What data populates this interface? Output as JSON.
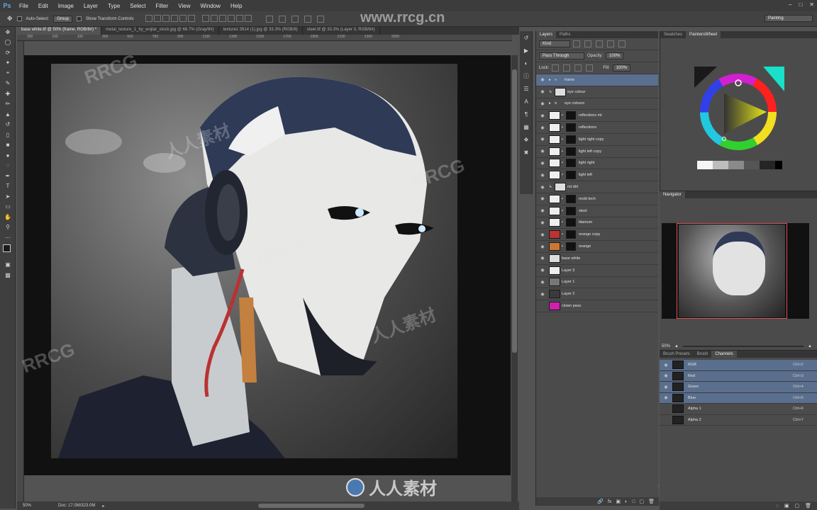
{
  "app": {
    "logo": "Ps",
    "workspace": "Painting"
  },
  "menu": [
    "File",
    "Edit",
    "Image",
    "Layer",
    "Type",
    "Select",
    "Filter",
    "View",
    "Window",
    "Help"
  ],
  "options": {
    "auto_select_label": "Auto-Select:",
    "auto_select_value": "Group",
    "transform_label": "Show Transform Controls"
  },
  "doc_tabs": [
    {
      "label": "base white.tif @ 50% (frame, RGB/8#) *",
      "active": true
    },
    {
      "label": "metal_texture_1_by_wojtar_stock.jpg @ 66.7% (Gray/8#)",
      "active": false
    },
    {
      "label": "texturez 3914 (1).jpg @ 33.3% (RGB/8)",
      "active": false
    },
    {
      "label": "steel.tif @ 33.3% (Layer 0, RGB/8#)",
      "active": false
    }
  ],
  "ruler": [
    "300",
    "100",
    "100",
    "300",
    "500",
    "700",
    "900",
    "1100",
    "1300",
    "1500",
    "1700",
    "1900",
    "2100",
    "2300",
    "2500"
  ],
  "status": {
    "zoom": "50%",
    "doc": "Doc: 17.0M/323.0M"
  },
  "watermark": {
    "site": "www.rrcg.cn",
    "brand": "RRCG",
    "cn": "人人素材"
  },
  "layers_panel": {
    "tabs": [
      "Layers",
      "Paths"
    ],
    "kind": "Kind",
    "blend": "Pass Through",
    "opacity_label": "Opacity:",
    "opacity": "100%",
    "lock_label": "Lock:",
    "fill_label": "Fill:",
    "fill": "100%",
    "layers": [
      {
        "name": "frame",
        "type": "group",
        "selected": true
      },
      {
        "name": "eye colour",
        "type": "clip",
        "selected": false
      },
      {
        "name": "eye colours",
        "type": "group",
        "selected": false
      },
      {
        "name": "reflections mt",
        "type": "mask",
        "selected": false
      },
      {
        "name": "reflections",
        "type": "mask",
        "selected": false
      },
      {
        "name": "light right copy",
        "type": "mask",
        "selected": false
      },
      {
        "name": "light left copy",
        "type": "mask",
        "selected": false
      },
      {
        "name": "light right",
        "type": "mask",
        "selected": false
      },
      {
        "name": "light left",
        "type": "mask",
        "selected": false
      },
      {
        "name": "mt dirt",
        "type": "clip",
        "selected": false
      },
      {
        "name": "mold tech",
        "type": "mask",
        "selected": false
      },
      {
        "name": "steel",
        "type": "mask",
        "selected": false
      },
      {
        "name": "titanium",
        "type": "mask",
        "selected": false
      },
      {
        "name": "orange copy",
        "type": "mask",
        "selected": false
      },
      {
        "name": "orange",
        "type": "mask",
        "selected": false
      },
      {
        "name": "base white",
        "type": "plain",
        "selected": false
      },
      {
        "name": "Layer 3",
        "type": "plain",
        "selected": false
      },
      {
        "name": "Layer 1",
        "type": "plain",
        "selected": false
      },
      {
        "name": "Layer 2",
        "type": "plain",
        "selected": false
      },
      {
        "name": "clown pass",
        "type": "plain",
        "selected": false
      }
    ]
  },
  "swatches_panel": {
    "tabs": [
      "Swatches",
      "PaintersWheel"
    ]
  },
  "navigator_panel": {
    "title": "Navigator",
    "zoom": "50%"
  },
  "channels_panel": {
    "tabs": [
      "Brush Presets",
      "Brush",
      "Channels"
    ],
    "channels": [
      {
        "name": "RGB",
        "key": "Ctrl+2",
        "selected": true
      },
      {
        "name": "Red",
        "key": "Ctrl+3",
        "selected": true
      },
      {
        "name": "Green",
        "key": "Ctrl+4",
        "selected": true
      },
      {
        "name": "Blue",
        "key": "Ctrl+5",
        "selected": true
      },
      {
        "name": "Alpha 1",
        "key": "Ctrl+6",
        "selected": false
      },
      {
        "name": "Alpha 2",
        "key": "Ctrl+7",
        "selected": false
      }
    ]
  },
  "colors": {
    "selection": "#5a6f8e",
    "accent_red": "#e05050",
    "magenta": "#d020b0"
  }
}
